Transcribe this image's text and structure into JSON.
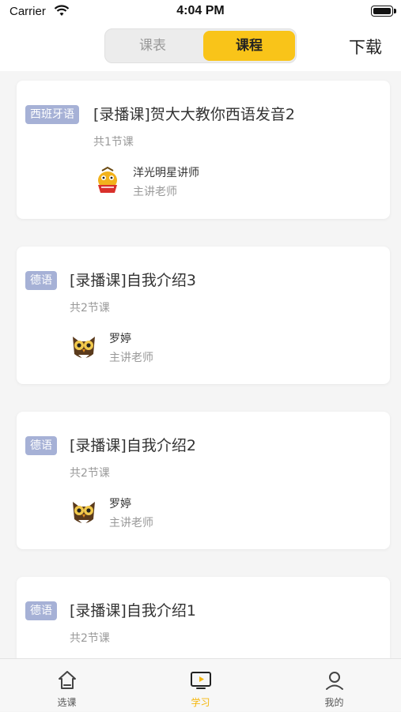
{
  "status_bar": {
    "carrier": "Carrier",
    "time": "4:04 PM"
  },
  "nav": {
    "segments": [
      "课表",
      "课程"
    ],
    "active_segment": "课程",
    "download_label": "下载"
  },
  "courses": [
    {
      "tag": "西班牙语",
      "title": "[录播课]贺大大教你西语发音2",
      "lessons": "共1节课",
      "teacher_name": "洋光明星讲师",
      "teacher_role": "主讲老师",
      "avatar_icon": "mascot-avatar-icon"
    },
    {
      "tag": "德语",
      "title": "[录播课]自我介绍3",
      "lessons": "共2节课",
      "teacher_name": "罗婷",
      "teacher_role": "主讲老师",
      "avatar_icon": "owl-avatar-icon"
    },
    {
      "tag": "德语",
      "title": "[录播课]自我介绍2",
      "lessons": "共2节课",
      "teacher_name": "罗婷",
      "teacher_role": "主讲老师",
      "avatar_icon": "owl-avatar-icon"
    },
    {
      "tag": "德语",
      "title": "[录播课]自我介绍1",
      "lessons": "共2节课",
      "teacher_name": "",
      "teacher_role": "",
      "avatar_icon": ""
    }
  ],
  "tab_bar": {
    "items": [
      {
        "label": "选课",
        "icon": "home-icon"
      },
      {
        "label": "学习",
        "icon": "play-screen-icon"
      },
      {
        "label": "我的",
        "icon": "person-icon"
      }
    ],
    "active": "学习"
  },
  "colors": {
    "accent": "#f9c419",
    "tag_bg": "#a6b1d6",
    "active_tab": "#f5b70f"
  }
}
